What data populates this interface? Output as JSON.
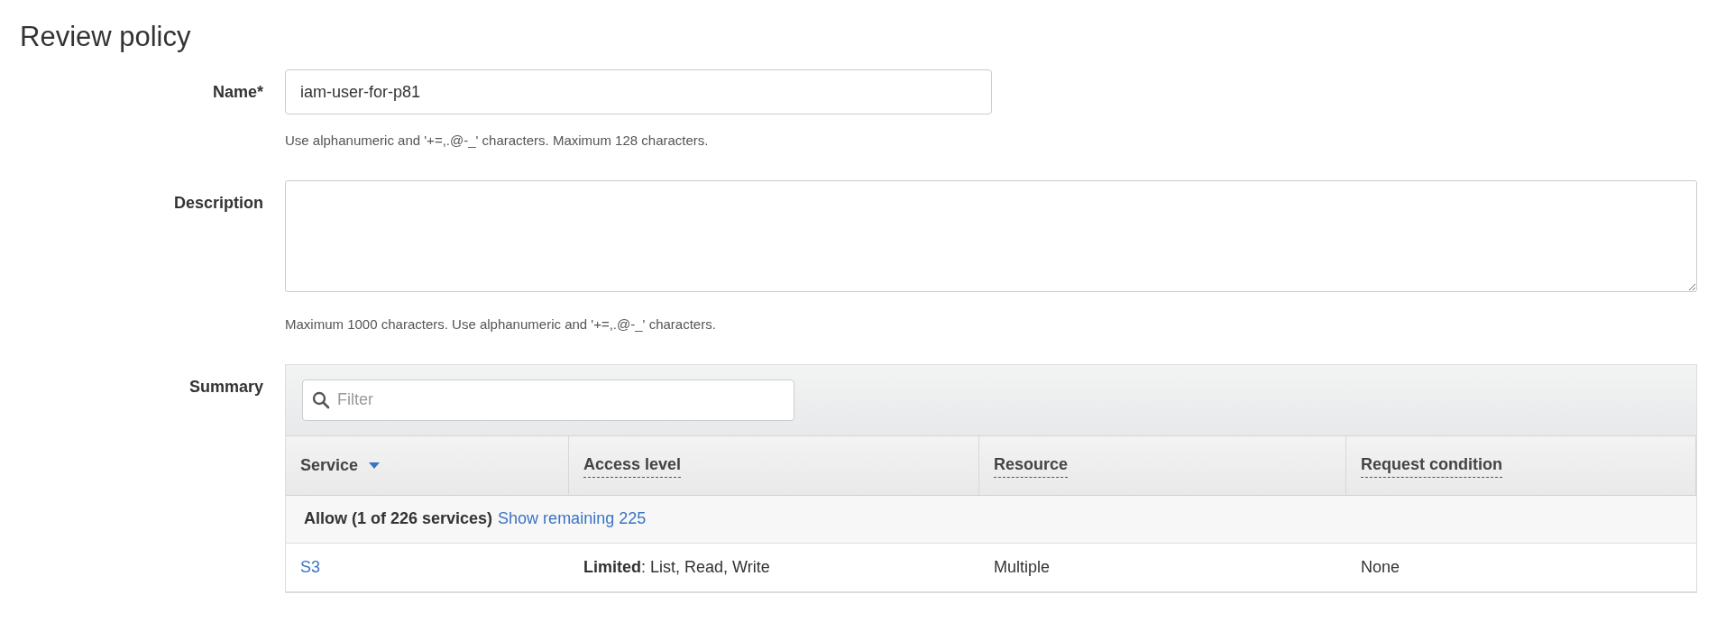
{
  "title": "Review policy",
  "fields": [
    {
      "kind": "input",
      "label": "Name*",
      "value": "iam-user-for-p81",
      "hint": "Use alphanumeric and '+=,.@-_' characters. Maximum 128 characters."
    },
    {
      "kind": "textarea",
      "label": "Description",
      "hint": "Maximum 1000 characters. Use alphanumeric and '+=,.@-_' characters."
    }
  ],
  "summary": {
    "label": "Summary",
    "filter": {
      "placeholder": "Filter"
    },
    "columns": [
      {
        "label": "Service",
        "kind": "sortable"
      },
      {
        "label": "Access level",
        "kind": "tooltip"
      },
      {
        "label": "Resource",
        "kind": "tooltip"
      },
      {
        "label": "Request condition",
        "kind": "tooltip"
      }
    ],
    "group": {
      "text": "Allow (1 of 226 services)",
      "link": "Show remaining 225"
    },
    "rows": [
      {
        "service": "S3",
        "access_level": "**Limited**: List, Read, Write",
        "resource": "Multiple",
        "request_condition": "None"
      }
    ]
  }
}
